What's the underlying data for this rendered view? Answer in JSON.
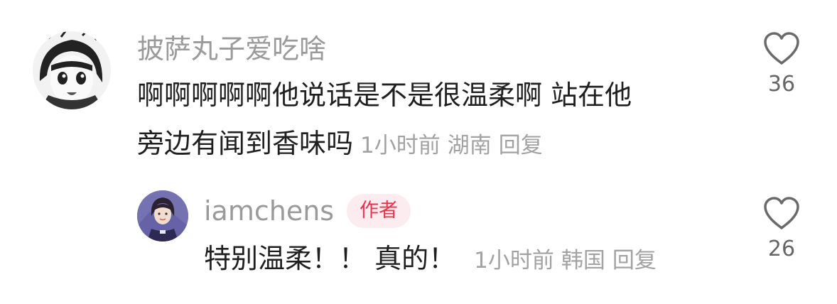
{
  "comment": {
    "author": "披萨丸子爱吃啥",
    "line1": "啊啊啊啊啊他说话是不是很温柔啊 站在他",
    "line2": "旁边有闻到香味吗",
    "time": "1小时前",
    "location": "湖南",
    "reply_label": "回复",
    "like_count": "36",
    "like_icon": "heart-outline-icon"
  },
  "reply": {
    "author": "iamchens",
    "badge": "作者",
    "text": "特别温柔！！ 真的！",
    "time": "1小时前",
    "location": "韩国",
    "reply_label": "回复",
    "like_count": "26",
    "like_icon": "heart-outline-icon"
  },
  "colors": {
    "meta_gray": "#a2a2a2",
    "badge_text": "#e8334d",
    "badge_bg": "#fdecef"
  }
}
